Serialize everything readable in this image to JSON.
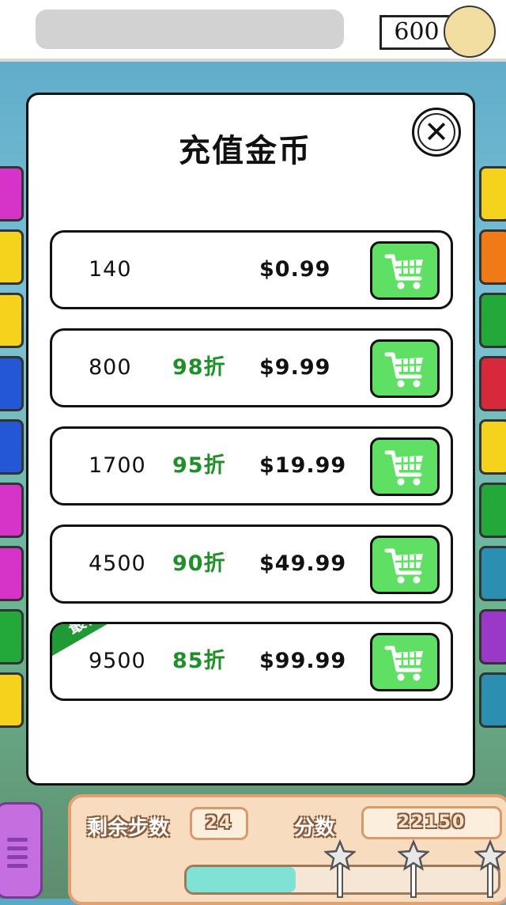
{
  "top_bar": {
    "coins": "600"
  },
  "modal": {
    "title": "充值金币",
    "packages": [
      {
        "amount": "140",
        "discount": "",
        "price": "$0.99"
      },
      {
        "amount": "800",
        "discount": "98折",
        "price": "$9.99"
      },
      {
        "amount": "1700",
        "discount": "95折",
        "price": "$19.99"
      },
      {
        "amount": "4500",
        "discount": "90折",
        "price": "$49.99"
      },
      {
        "amount": "9500",
        "discount": "85折",
        "price": "$99.99",
        "badge": "最优惠"
      }
    ]
  },
  "hud": {
    "moves_label": "剩余步数",
    "moves": "24",
    "score_label": "分数",
    "score": "22150",
    "progress_fraction": 0.35
  },
  "icons": [
    "close-icon",
    "cart-icon",
    "coin-icon",
    "star-icon",
    "menu-icon"
  ],
  "colors": {
    "buy_button": "#5fe065",
    "discount_text": "#1f8f2a",
    "badge": "#1f9a35",
    "coin": "#f2dea0"
  }
}
